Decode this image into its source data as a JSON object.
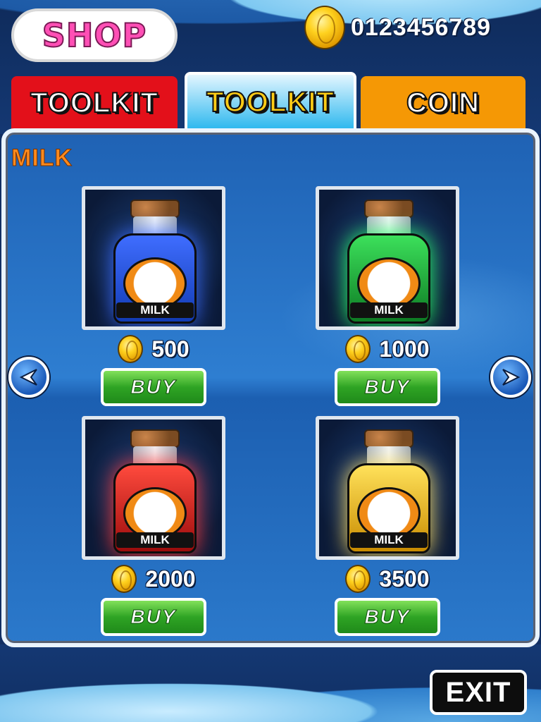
{
  "header": {
    "logo_text": "SHOP",
    "coin_total": "0123456789"
  },
  "tabs": [
    {
      "label": "TOOLKIT",
      "color": "#e3101a",
      "active": false
    },
    {
      "label": "TOOLKIT",
      "color": "#2bb7ee",
      "active": true
    },
    {
      "label": "COIN",
      "color": "#f59805",
      "active": false
    }
  ],
  "section": {
    "title": "MILK"
  },
  "products": [
    {
      "label": "MILK",
      "liquid_color": "blue",
      "price": "500",
      "buy_label": "BUY"
    },
    {
      "label": "MILK",
      "liquid_color": "green",
      "price": "1000",
      "buy_label": "BUY"
    },
    {
      "label": "MILK",
      "liquid_color": "red",
      "price": "2000",
      "buy_label": "BUY"
    },
    {
      "label": "MILK",
      "liquid_color": "gold",
      "price": "3500",
      "buy_label": "BUY"
    }
  ],
  "navigation": {
    "prev_icon": "arrow-left-icon",
    "next_icon": "arrow-right-icon"
  },
  "exit_label": "EXIT"
}
